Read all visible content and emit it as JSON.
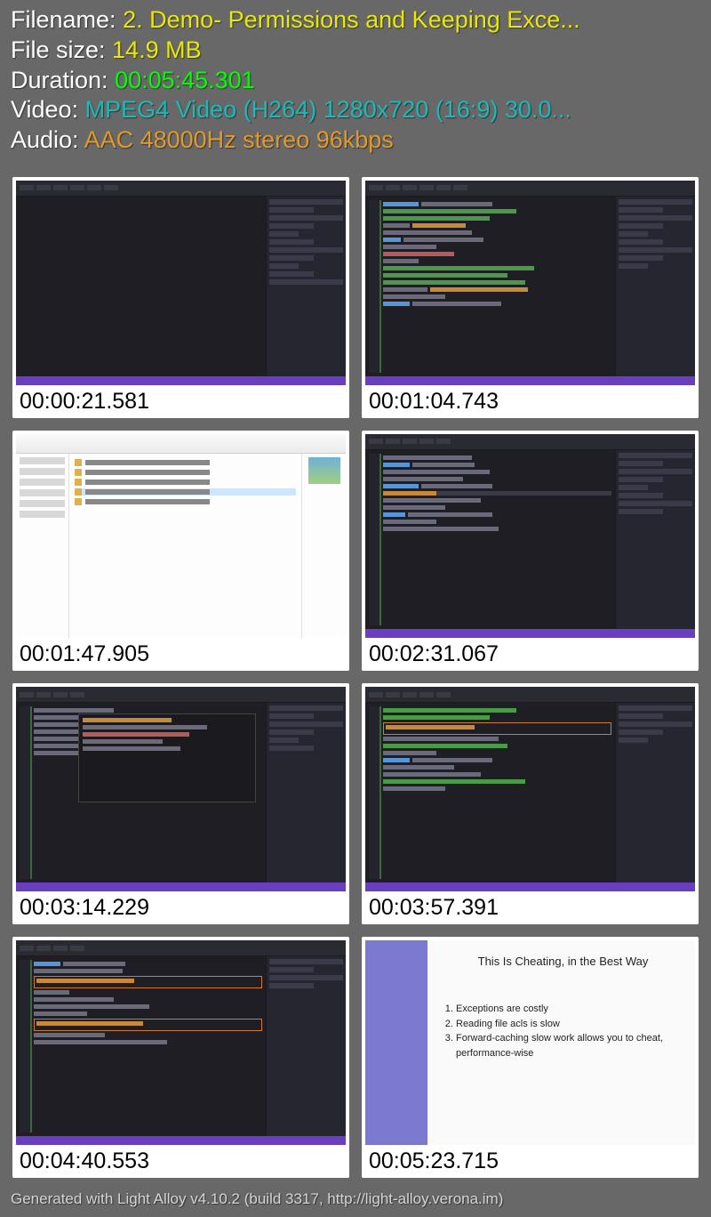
{
  "info": {
    "filename_label": "Filename: ",
    "filename_value": "2. Demo- Permissions and Keeping Exce...",
    "filesize_label": "File size: ",
    "filesize_value": "14.9 MB",
    "duration_label": "Duration: ",
    "duration_value": "00:05:45.301",
    "video_label": "Video: ",
    "video_value": "MPEG4 Video (H264) 1280x720 (16:9) 30.0...",
    "audio_label": "Audio: ",
    "audio_value": "AAC 48000Hz stereo 96kbps"
  },
  "thumbnails": [
    {
      "timestamp": "00:00:21.581",
      "kind": "vs-dark-empty"
    },
    {
      "timestamp": "00:01:04.743",
      "kind": "vs-dark-code"
    },
    {
      "timestamp": "00:01:47.905",
      "kind": "explorer"
    },
    {
      "timestamp": "00:02:31.067",
      "kind": "vs-dark-code"
    },
    {
      "timestamp": "00:03:14.229",
      "kind": "vs-dark-popup"
    },
    {
      "timestamp": "00:03:57.391",
      "kind": "vs-dark-highlight"
    },
    {
      "timestamp": "00:04:40.553",
      "kind": "vs-dark-boxes"
    },
    {
      "timestamp": "00:05:23.715",
      "kind": "slide"
    }
  ],
  "slide": {
    "title": "This Is Cheating, in the Best Way",
    "points": [
      "Exceptions are costly",
      "Reading file acls is slow",
      "Forward-caching slow work allows you to cheat, performance-wise"
    ]
  },
  "footer": "Generated with Light Alloy v4.10.2 (build 3317, http://light-alloy.verona.im)"
}
